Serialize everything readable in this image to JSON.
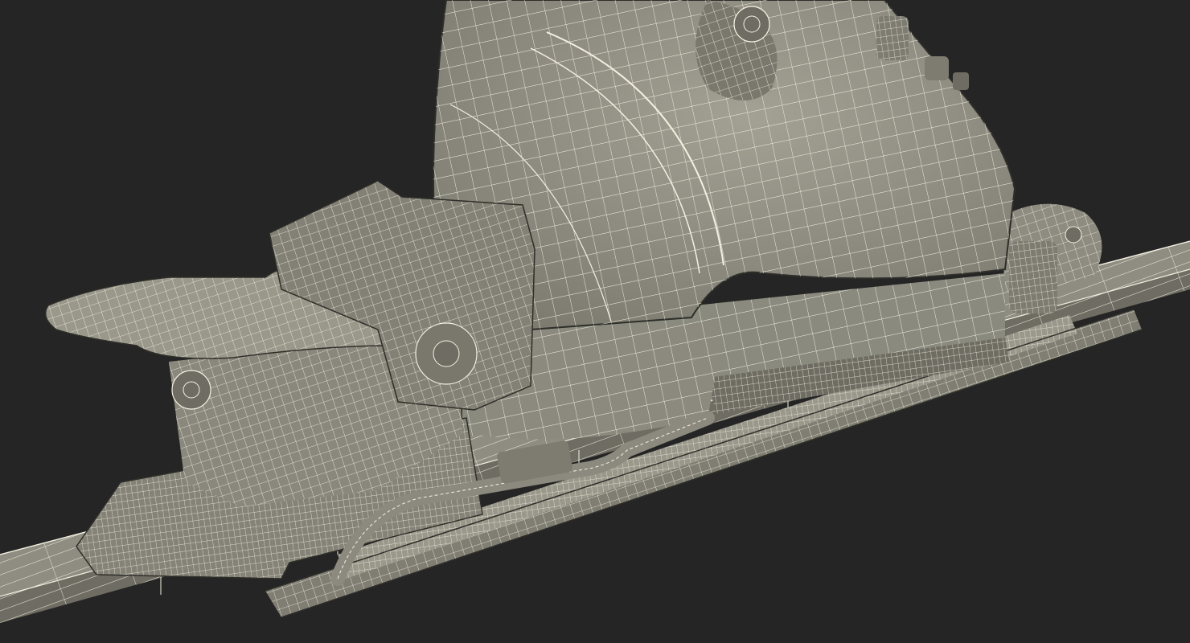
{
  "viewport": {
    "background": "#252525",
    "render_style": "wireframe-on-shaded",
    "subject": "ski-boot-in-binding-on-ski"
  },
  "palette": {
    "mesh_fill": "#8e8c80",
    "mesh_fill_dark": "#6f6d63",
    "mesh_fill_light": "#a3a194",
    "wire": "#f4f1e2",
    "outline": "#2e2e2a"
  }
}
